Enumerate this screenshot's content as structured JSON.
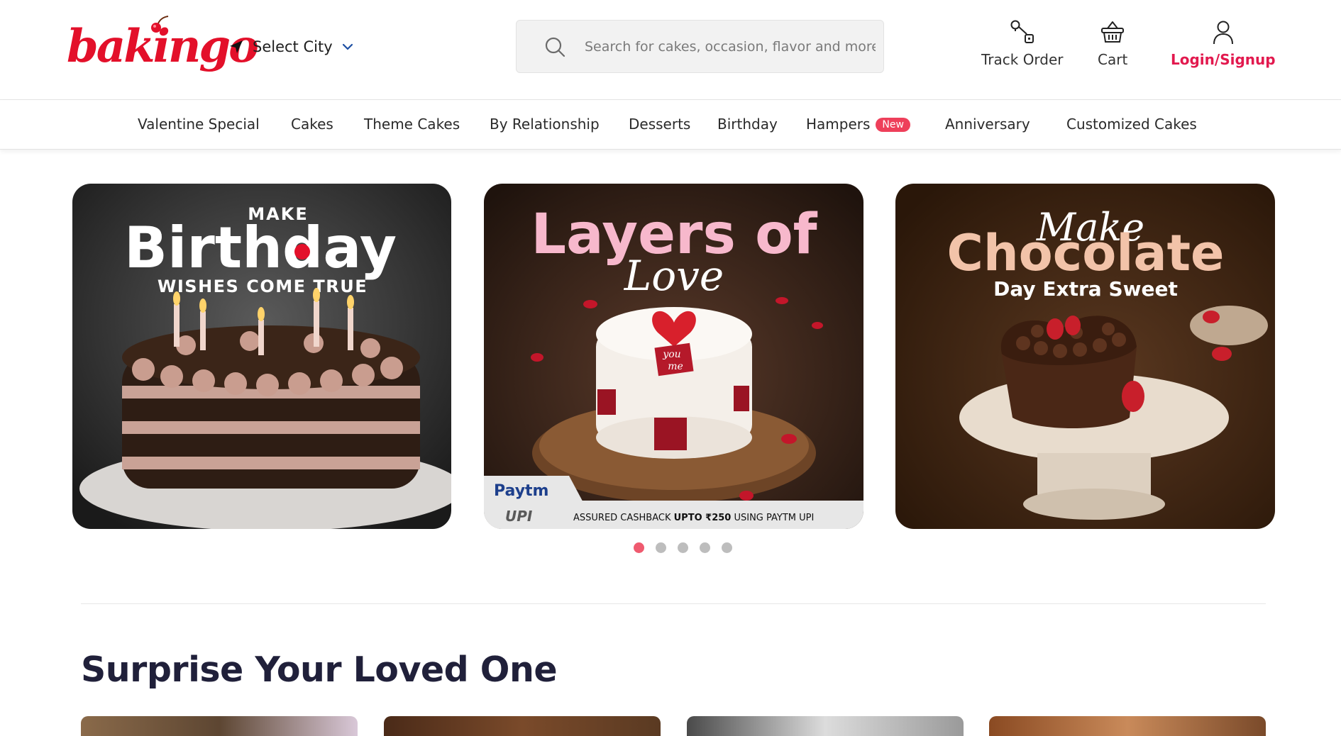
{
  "header": {
    "logo_text": "bakingo",
    "city_label": "Select City",
    "search_placeholder": "Search for cakes, occasion, flavor and more",
    "track_order": "Track Order",
    "cart": "Cart",
    "login": "Login/Signup"
  },
  "nav": {
    "items": [
      "Valentine Special",
      "Cakes",
      "Theme Cakes",
      "By Relationship",
      "Desserts",
      "Birthday",
      "Hampers",
      "Anniversary",
      "Customized Cakes"
    ],
    "new_badge": "New"
  },
  "banners": [
    {
      "top": "MAKE",
      "headline": "Birthday",
      "sub": "WISHES COME TRUE"
    },
    {
      "headline": "Layers of",
      "script": "Love",
      "tag1": "you",
      "tag2": "me",
      "pay_brand": "Paytm",
      "pay_sub": "UPI",
      "cashback_prefix": "ASSURED CASHBACK ",
      "cashback_bold": "UPTO ₹250",
      "cashback_suffix": " USING PAYTM UPI"
    },
    {
      "script": "Make",
      "headline": "Chocolate",
      "sub": "Day Extra Sweet"
    }
  ],
  "carousel": {
    "count": 5,
    "active": 0
  },
  "section": {
    "title": "Surprise Your Loved One"
  },
  "colors": {
    "brand": "#e3102a",
    "accent": "#e2194e",
    "badge": "#ee3f5a",
    "dot_active": "#ef5a6f"
  }
}
